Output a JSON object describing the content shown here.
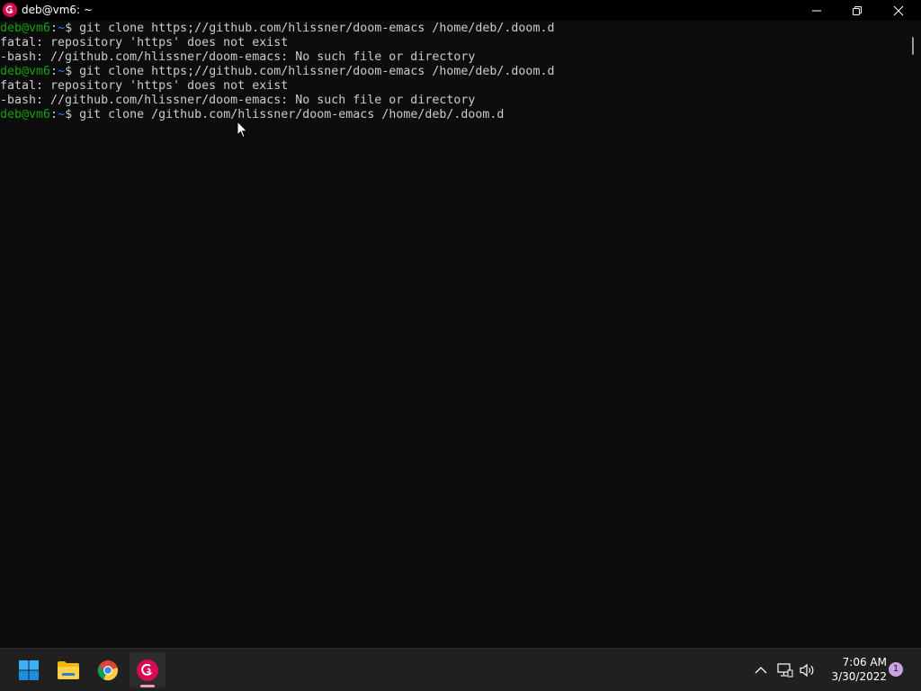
{
  "window": {
    "title": "deb@vm6: ~",
    "icon": "debian-swirl-icon"
  },
  "colors": {
    "terminal_bg": "#0c0c0c",
    "prompt_user": "#13a10e",
    "prompt_path": "#3b78ff",
    "text": "#cccccc",
    "debian_red": "#d70a53"
  },
  "terminal": {
    "lines": [
      {
        "prompt_user": "deb@vm6",
        "prompt_colon": ":",
        "prompt_path": "~",
        "prompt_dollar": "$",
        "command": " git clone https;//github.com/hlissner/doom-emacs /home/deb/.doom.d"
      },
      {
        "text": "fatal: repository 'https' does not exist"
      },
      {
        "text": "-bash: //github.com/hlissner/doom-emacs: No such file or directory"
      },
      {
        "prompt_user": "deb@vm6",
        "prompt_colon": ":",
        "prompt_path": "~",
        "prompt_dollar": "$",
        "command": " git clone https;//github.com/hlissner/doom-emacs /home/deb/.doom.d"
      },
      {
        "text": "fatal: repository 'https' does not exist"
      },
      {
        "text": "-bash: //github.com/hlissner/doom-emacs: No such file or directory"
      },
      {
        "prompt_user": "deb@vm6",
        "prompt_colon": ":",
        "prompt_path": "~",
        "prompt_dollar": "$",
        "command": " git clone /github.com/hlissner/doom-emacs /home/deb/.doom.d"
      }
    ]
  },
  "taskbar": {
    "apps": [
      "windows-start-icon",
      "file-explorer-icon",
      "chrome-icon",
      "debian-terminal-icon"
    ],
    "tray": [
      "chevron-up-icon",
      "network-icon",
      "volume-icon"
    ],
    "time": "7:06 AM",
    "date": "3/30/2022",
    "notification_count": "1"
  }
}
